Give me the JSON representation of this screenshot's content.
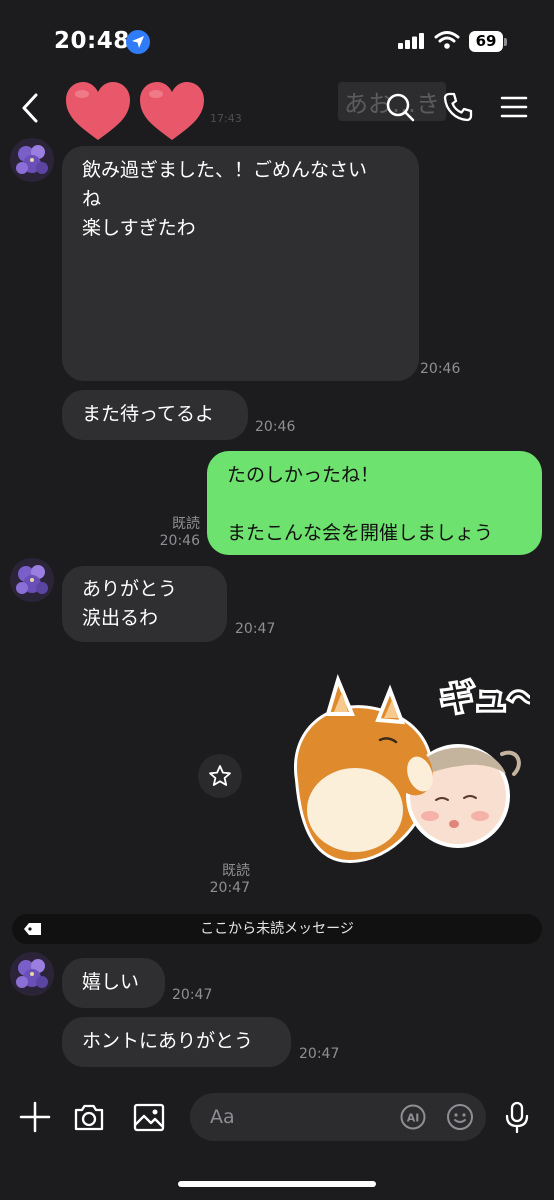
{
  "status_bar": {
    "time": "20:48",
    "battery": "69"
  },
  "header": {
    "faded_time": "17:43",
    "faded_banner": "あお…き"
  },
  "messages": [
    {
      "text": "飲み過ぎました、！ごめんなさい\nね\n楽しすぎたわ",
      "time": "20:46"
    },
    {
      "text": "また待ってるよ",
      "time": "20:46"
    },
    {
      "text": "たのしかったね！\n\nまたこんな会を開催しましょう",
      "read": "既読",
      "time": "20:46"
    },
    {
      "text": "ありがとう\n涙出るわ",
      "time": "20:47"
    },
    {
      "sticker_text": "ギュ〜",
      "read": "既読",
      "time": "20:47"
    },
    {
      "text": "嬉しい",
      "time": "20:47"
    },
    {
      "text": "ホントにありがとう",
      "time": "20:47"
    }
  ],
  "unread_divider": "ここから未読メッセージ",
  "input": {
    "placeholder": "Aa",
    "ai_label": "AI"
  },
  "colors": {
    "outgoing": "#6ee26f",
    "incoming": "#2f2f31",
    "background": "#1c1c1e"
  }
}
